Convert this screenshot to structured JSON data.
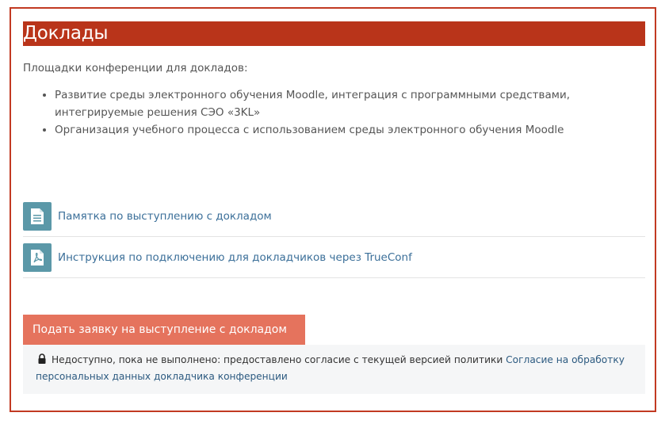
{
  "section": {
    "title": "Доклады",
    "intro": "Площадки конференции для докладов:",
    "topics": [
      "Развитие среды электронного обучения Moodle, интеграция с программными средствами, интегрируемые решения СЭО «3KL»",
      "Организация учебного процесса с использованием среды электронного обучения Moodle"
    ]
  },
  "resources": [
    {
      "icon": "document-icon",
      "label": "Памятка по выступлению с докладом"
    },
    {
      "icon": "pdf-icon",
      "label": "Инструкция по подключению для докладчиков через TrueConf"
    }
  ],
  "apply_button": {
    "label": "Подать заявку на выступление с докладом"
  },
  "restriction": {
    "icon": "lock-icon",
    "text": "Недоступно, пока не выполнено: предоставлено согласие с текущей версией политики ",
    "link": "Согласие на обработку персональных данных докладчика конференции"
  },
  "colors": {
    "banner": "#b9341a",
    "frame": "#c23a22",
    "button": "#e5735d",
    "icon_bg": "#5b98a8",
    "link": "#3b6f99"
  }
}
